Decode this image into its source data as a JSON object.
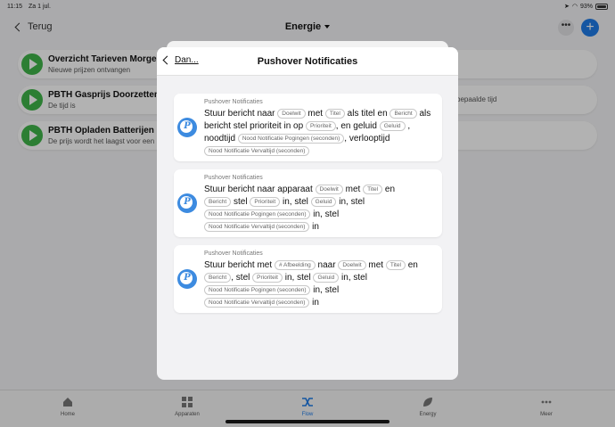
{
  "status": {
    "time": "11:15",
    "date": "Za 1 jul.",
    "battery": "93%"
  },
  "nav": {
    "back_label": "Terug",
    "title": "Energie",
    "more": "•••",
    "add": "+"
  },
  "flows": [
    {
      "title": "Overzicht Tarieven Morgen",
      "subtitle": "Nieuwe prijzen ontvangen",
      "right": ""
    },
    {
      "title": "PBTH Gasprijs Doorzetten",
      "subtitle": "De tijd is",
      "right": "bepaalde tijd"
    },
    {
      "title": "PBTH Opladen Batterijen Na",
      "subtitle": "De prijs wordt het laagst voor een",
      "right": ""
    }
  ],
  "tabs": [
    {
      "label": "Home",
      "icon": "home-icon"
    },
    {
      "label": "Apparaten",
      "icon": "grid-icon"
    },
    {
      "label": "Flow",
      "icon": "flow-icon"
    },
    {
      "label": "Energy",
      "icon": "leaf-icon"
    },
    {
      "label": "Meer",
      "icon": "dots-icon"
    }
  ],
  "modal": {
    "back_label": "Dan...",
    "title": "Pushover Notificaties",
    "cards": [
      {
        "app": "Pushover Notificaties",
        "t1": "Stuur bericht naar",
        "p1": "Doelwit",
        "t2": "met",
        "p2": "Titel",
        "t3": "als titel en",
        "p3": "Bericht",
        "t4": "als bericht stel prioriteit in op",
        "p4": "Prioriteit",
        "t5": ", en geluid",
        "p5": "Geluid",
        "t6": ", noodtijd",
        "p6": "Nood Notificatie Pogingen (seconden)",
        "t7": ", verlooptijd",
        "p7": "Nood Notificatie Vervaltijd (seconden)"
      },
      {
        "app": "Pushover Notificaties",
        "t1": "Stuur bericht naar apparaat",
        "p1": "Doelwit",
        "t2": "met",
        "p2": "Titel",
        "t3": "en",
        "p3": "Bericht",
        "t4": "stel",
        "p4": "Prioriteit",
        "t5": "in, stel",
        "p5": "Geluid",
        "t6": "in, stel",
        "p6": "Nood Notificatie Pogingen (seconden)",
        "t7": "in, stel",
        "p7": "Nood Notificatie Vervaltijd (seconden)",
        "t8": "in"
      },
      {
        "app": "Pushover Notificaties",
        "t1": "Stuur bericht met",
        "p1": "# Afbeelding",
        "t2": "naar",
        "p2": "Doelwit",
        "t3": "met",
        "p3": "Titel",
        "t4": "en",
        "p4": "Bericht",
        "t5": ", stel",
        "p5": "Prioriteit",
        "t6": "in, stel",
        "p6": "Geluid",
        "t7": "in, stel",
        "p7": "Nood Notificatie Pogingen (seconden)",
        "t8": "in, stel",
        "p8": "Nood Notificatie Vervaltijd (seconden)",
        "t9": "in"
      }
    ]
  }
}
